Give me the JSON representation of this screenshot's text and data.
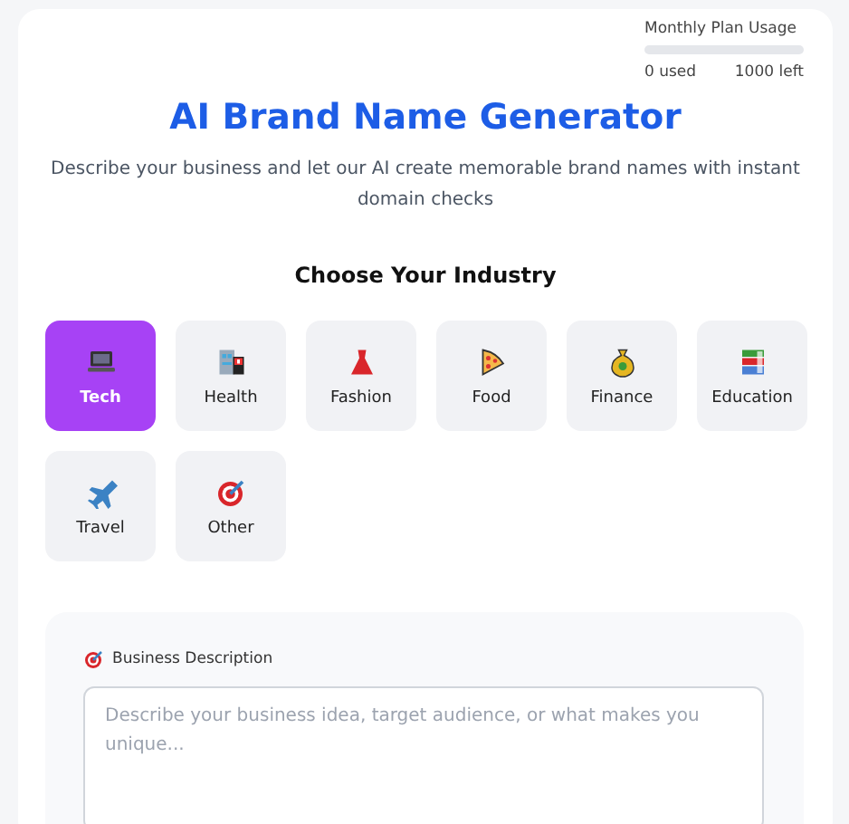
{
  "usage": {
    "title": "Monthly Plan Usage",
    "level": 0,
    "used": "0 used",
    "left": "1000 left"
  },
  "header": {
    "title": "AI Brand Name Generator",
    "subtitle": "Describe your business and let our AI create memorable brand names with instant domain checks"
  },
  "industry": {
    "heading": "Choose Your Industry",
    "options": [
      {
        "label": "Tech",
        "selected": true
      },
      {
        "label": "Health",
        "selected": false
      },
      {
        "label": "Fashion",
        "selected": false
      },
      {
        "label": "Food",
        "selected": false
      },
      {
        "label": "Finance",
        "selected": false
      },
      {
        "label": "Education",
        "selected": false
      },
      {
        "label": "Travel",
        "selected": false
      },
      {
        "label": "Other",
        "selected": false
      }
    ]
  },
  "form": {
    "label": "Business Description",
    "placeholder": "Describe your business idea, target audience, or what makes you unique..."
  }
}
